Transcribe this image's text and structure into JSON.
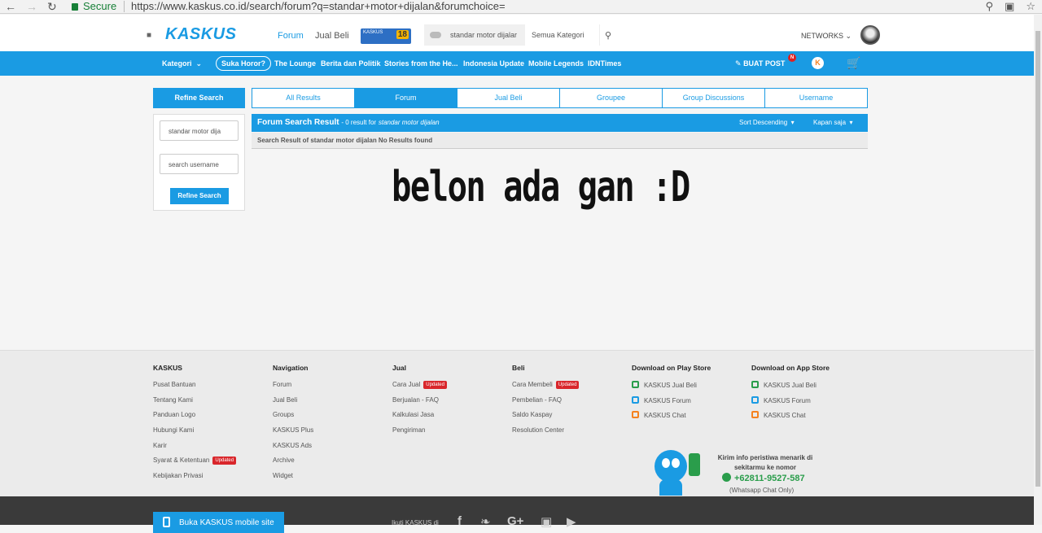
{
  "browser": {
    "secure_label": "Secure",
    "url": "https://www.kaskus.co.id/search/forum?q=standar+motor+dijalan&forumchoice="
  },
  "topnav": {
    "logo": "KASKUS",
    "forum": "Forum",
    "jual_beli": "Jual Beli",
    "badge_text": "KASKUS",
    "badge_num": "18",
    "search_value": "standar motor dijalar",
    "category": "Semua Kategori",
    "networks": "NETWORKS"
  },
  "bluebar": {
    "kategori": "Kategori",
    "items": [
      "Suka Horor?",
      "The Lounge",
      "Berita dan Politik",
      "Stories from the He...",
      "Indonesia Update",
      "Mobile Legends",
      "IDNTimes"
    ],
    "buat_post": "BUAT POST",
    "notif": "N"
  },
  "left": {
    "header": "Refine Search",
    "keyword_value": "standar motor dija",
    "username_placeholder": "search username",
    "button": "Refine Search"
  },
  "tabs": [
    "All Results",
    "Forum",
    "Jual Beli",
    "Groupee",
    "Group Discussions",
    "Username"
  ],
  "result": {
    "title": "Forum Search Result",
    "count_text": "- 0 result for",
    "query": "standar motor dijalan",
    "sort": "Sort Descending",
    "kapan": "Kapan saja",
    "sub": "Search Result of standar motor dijalan No Results found"
  },
  "message": "belon ada gan :D",
  "footer": {
    "kaskus": {
      "title": "KASKUS",
      "items": [
        "Pusat Bantuan",
        "Tentang Kami",
        "Panduan Logo",
        "Hubungi Kami",
        "Karir",
        "Syarat & Ketentuan",
        "Kebijakan Privasi"
      ]
    },
    "navigation": {
      "title": "Navigation",
      "items": [
        "Forum",
        "Jual Beli",
        "Groups",
        "KASKUS Plus",
        "KASKUS Ads",
        "Archive",
        "Widget"
      ]
    },
    "jual": {
      "title": "Jual",
      "items": [
        "Cara Jual",
        "Berjualan - FAQ",
        "Kalkulasi Jasa",
        "Pengiriman"
      ]
    },
    "beli": {
      "title": "Beli",
      "items": [
        "Cara Membeli",
        "Pembelian - FAQ",
        "Saldo Kaspay",
        "Resolution Center"
      ]
    },
    "play_store": {
      "title": "Download on Play Store",
      "items": [
        "KASKUS Jual Beli",
        "KASKUS Forum",
        "KASKUS Chat"
      ]
    },
    "app_store": {
      "title": "Download on App Store",
      "items": [
        "KASKUS Jual Beli",
        "KASKUS Forum",
        "KASKUS Chat"
      ]
    },
    "updated_label": "Updated",
    "wa_text": "Kirim info peristiwa menarik di sekitarmu ke nomor",
    "wa_number": "+62811-9527-587",
    "wa_only": "(Whatsapp Chat Only)"
  },
  "bottom": {
    "mobile_button": "Buka KASKUS mobile site",
    "ikuti": "Ikuti KASKUS di"
  }
}
